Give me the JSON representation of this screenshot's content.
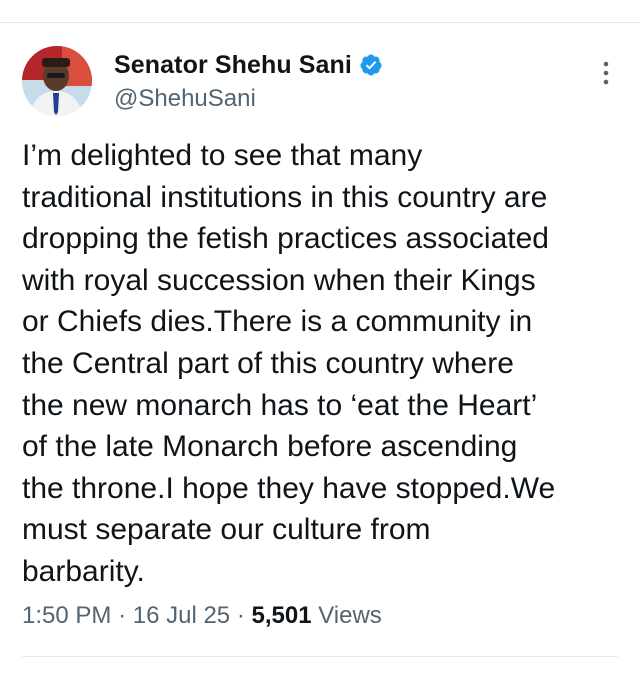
{
  "author": {
    "display_name": "Senator Shehu Sani",
    "handle": "@ShehuSani",
    "verified": true
  },
  "tweet": {
    "text": "I’m delighted to see that many\ntraditional institutions in this country are\ndropping the fetish practices associated\nwith royal succession when their Kings\nor Chiefs dies.There is a community in\nthe Central part of this country where\nthe new monarch has to ‘eat the Heart’\nof the late Monarch before ascending\nthe throne.I hope they have stopped.We\nmust separate our culture from\nbarbarity.",
    "time": "1:50 PM",
    "date": "16 Jul 25",
    "separator": "·",
    "views_count": "5,501",
    "views_label": "Views"
  },
  "icons": {
    "verified": "verified-badge-icon",
    "more": "more-vertical-icon"
  },
  "colors": {
    "text": "#0f1419",
    "secondary": "#536471",
    "verified": "#1d9bf0",
    "divider": "#e7e9ea"
  }
}
